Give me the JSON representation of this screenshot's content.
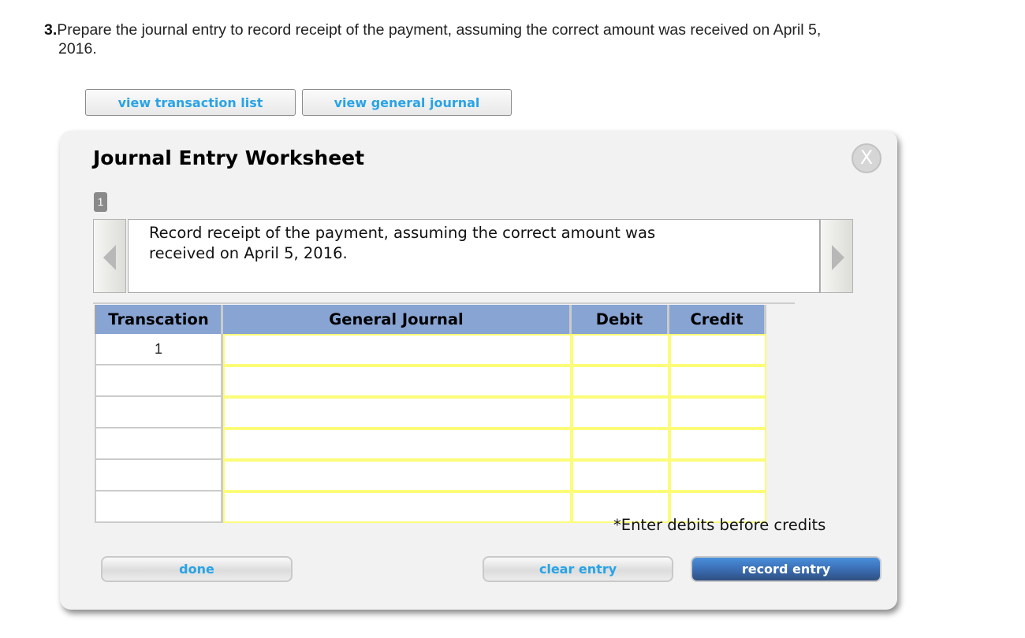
{
  "question": {
    "number": "3.",
    "text": "Prepare the journal entry to record receipt of the payment, assuming the correct amount was received on April 5,",
    "continuation": "2016."
  },
  "top_buttons": {
    "transaction_list": "view transaction list",
    "general_journal": "view general journal"
  },
  "worksheet": {
    "title": "Journal Entry Worksheet",
    "close_icon": "X",
    "step_number": "1",
    "description_line1": "Record receipt of the payment, assuming the correct amount was",
    "description_line2": "received on April 5, 2016.",
    "table": {
      "headers": [
        "Transcation",
        "General Journal",
        "Debit",
        "Credit"
      ],
      "rows": [
        {
          "transaction": "1",
          "account": "",
          "debit": "",
          "credit": ""
        },
        {
          "transaction": "",
          "account": "",
          "debit": "",
          "credit": ""
        },
        {
          "transaction": "",
          "account": "",
          "debit": "",
          "credit": ""
        },
        {
          "transaction": "",
          "account": "",
          "debit": "",
          "credit": ""
        },
        {
          "transaction": "",
          "account": "",
          "debit": "",
          "credit": ""
        },
        {
          "transaction": "",
          "account": "",
          "debit": "",
          "credit": ""
        }
      ]
    },
    "note": "*Enter debits before credits",
    "buttons": {
      "done": "done",
      "clear": "clear entry",
      "record": "record entry"
    }
  },
  "colors": {
    "link_blue": "#29a3e6",
    "header_blue": "#87a4d3",
    "input_border_yellow": "#fcfc78",
    "record_button": "#3a6bb0"
  }
}
